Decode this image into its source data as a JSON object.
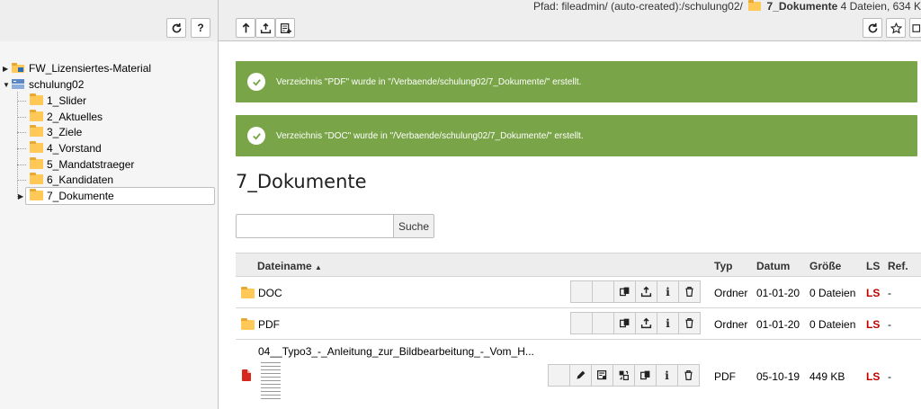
{
  "header": {
    "path_label": "Pfad: fileadmin/ (auto-created):/schulung02/",
    "current_folder": "7_Dokumente",
    "summary": "4 Dateien, 634 K"
  },
  "tree": {
    "root_items": [
      {
        "label": "FW_Lizensiertes-Material"
      },
      {
        "label": "schulung02"
      }
    ],
    "children": [
      {
        "label": "1_Slider"
      },
      {
        "label": "2_Aktuelles"
      },
      {
        "label": "3_Ziele"
      },
      {
        "label": "4_Vorstand"
      },
      {
        "label": "5_Mandatstraeger"
      },
      {
        "label": "6_Kandidaten"
      },
      {
        "label": "7_Dokumente"
      }
    ]
  },
  "messages": [
    {
      "text": "Verzeichnis \"PDF\" wurde in \"/Verbaende/schulung02/7_Dokumente/\" erstellt."
    },
    {
      "text": "Verzeichnis \"DOC\" wurde in \"/Verbaende/schulung02/7_Dokumente/\" erstellt."
    }
  ],
  "page_title": "7_Dokumente",
  "search": {
    "value": "",
    "button": "Suche"
  },
  "table": {
    "columns": {
      "name": "Dateiname",
      "sort": "▲",
      "type": "Typ",
      "date": "Datum",
      "size": "Größe",
      "ls": "LS",
      "ref": "Ref."
    },
    "rows": [
      {
        "name": "DOC",
        "type": "Ordner",
        "date": "01-01-20",
        "size": "0 Dateien",
        "ls": "LS",
        "ref": "-"
      },
      {
        "name": "PDF",
        "type": "Ordner",
        "date": "01-01-20",
        "size": "0 Dateien",
        "ls": "LS",
        "ref": "-"
      },
      {
        "name": "04__Typo3_-_Anleitung_zur_Bildbearbeitung_-_Vom_H...",
        "type": "PDF",
        "date": "05-10-19",
        "size": "449 KB",
        "ls": "LS",
        "ref": "-"
      }
    ]
  },
  "icons": {
    "info_glyph": "i",
    "help_glyph": "?"
  },
  "colors": {
    "flash_ok": "#79a548",
    "ls_red": "#c00000",
    "folder": "#ffc857"
  }
}
